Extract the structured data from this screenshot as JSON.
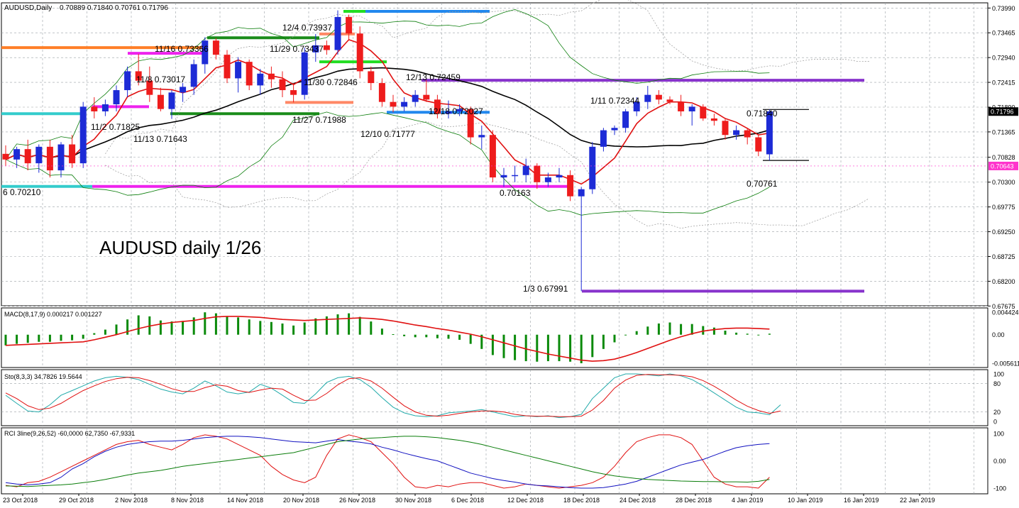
{
  "header": {
    "symbol": "AUDUSD,Daily",
    "ohlc": "0.70889 0.71840 0.70761 0.71796"
  },
  "watermark": "AUDUSD daily 1/26",
  "colors": {
    "bull": "#1d2bd6",
    "bear": "#ee1c1c",
    "ma_fast": "#e01010",
    "ma_slow": "#000000",
    "bb": "#0a7d0a",
    "grid": "#9aa0a6",
    "price_tag": "#000000",
    "level_tag": "#ff33cc",
    "cyan": "#33cccc",
    "orange": "#ff7f27",
    "magenta": "#ee22ee",
    "green": "#1a8c1a",
    "bright_green": "#22dd22",
    "blue": "#2288ee",
    "purple": "#8833cc",
    "salmon": "#ff8866"
  },
  "price_axis": {
    "labels": [
      "0.73990",
      "0.73465",
      "0.72940",
      "0.72415",
      "0.71890",
      "0.71365",
      "0.70828",
      "0.70300",
      "0.69775",
      "0.69250",
      "0.68725",
      "0.68200",
      "0.67675"
    ],
    "last_price": "0.71796",
    "level_tag": "0.70643"
  },
  "time_axis": {
    "labels": [
      "23 Oct 2018",
      "29 Oct 2018",
      "2 Nov 2018",
      "8 Nov 2018",
      "14 Nov 2018",
      "20 Nov 2018",
      "26 Nov 2018",
      "30 Nov 2018",
      "6 Dec 2018",
      "12 Dec 2018",
      "18 Dec 2018",
      "24 Dec 2018",
      "28 Dec 2018",
      "4 Jan 2019",
      "10 Jan 2019",
      "16 Jan 2019",
      "22 Jan 2019"
    ]
  },
  "annotations": [
    {
      "text": "12/4 0.73937"
    },
    {
      "text": "11/16 0.73366"
    },
    {
      "text": "11/29 0.73437"
    },
    {
      "text": "11/8 0.73017"
    },
    {
      "text": "11/30 0.72846"
    },
    {
      "text": "12/13 0.72459"
    },
    {
      "text": "1/11 0.72344"
    },
    {
      "text": "12/18 0.72027"
    },
    {
      "text": "0.71840"
    },
    {
      "text": "11/2 0.71825"
    },
    {
      "text": "11/27 0.71988"
    },
    {
      "text": "12/10 0.71777"
    },
    {
      "text": "11/13 0.71643"
    },
    {
      "text": "0.70761"
    },
    {
      "text": "6 0.70210"
    },
    {
      "text": "0.70163"
    },
    {
      "text": "1/3 0.67991"
    }
  ],
  "candles": [
    [
      0.709,
      0.7108,
      0.7065,
      0.7078
    ],
    [
      0.7078,
      0.7105,
      0.706,
      0.71
    ],
    [
      0.71,
      0.712,
      0.7055,
      0.707
    ],
    [
      0.707,
      0.711,
      0.705,
      0.7105
    ],
    [
      0.7105,
      0.712,
      0.704,
      0.7055
    ],
    [
      0.7055,
      0.7115,
      0.704,
      0.711
    ],
    [
      0.711,
      0.713,
      0.706,
      0.707
    ],
    [
      0.707,
      0.72,
      0.706,
      0.719
    ],
    [
      0.719,
      0.721,
      0.7165,
      0.718
    ],
    [
      0.718,
      0.7205,
      0.717,
      0.7195
    ],
    [
      0.7195,
      0.7235,
      0.718,
      0.7225
    ],
    [
      0.7225,
      0.7275,
      0.721,
      0.7265
    ],
    [
      0.7265,
      0.7302,
      0.7235,
      0.7245
    ],
    [
      0.7245,
      0.7275,
      0.72,
      0.7215
    ],
    [
      0.7215,
      0.723,
      0.718,
      0.7185
    ],
    [
      0.7185,
      0.7225,
      0.7164,
      0.722
    ],
    [
      0.722,
      0.724,
      0.72,
      0.7232
    ],
    [
      0.7232,
      0.729,
      0.7215,
      0.728
    ],
    [
      0.728,
      0.7337,
      0.726,
      0.733
    ],
    [
      0.733,
      0.7335,
      0.729,
      0.73
    ],
    [
      0.73,
      0.731,
      0.724,
      0.725
    ],
    [
      0.725,
      0.7295,
      0.722,
      0.7285
    ],
    [
      0.7285,
      0.729,
      0.7225,
      0.7235
    ],
    [
      0.7235,
      0.727,
      0.7215,
      0.726
    ],
    [
      0.726,
      0.7275,
      0.723,
      0.7248
    ],
    [
      0.7248,
      0.7265,
      0.721,
      0.7225
    ],
    [
      0.7225,
      0.724,
      0.7199,
      0.7215
    ],
    [
      0.7215,
      0.7315,
      0.7205,
      0.7305
    ],
    [
      0.7305,
      0.7344,
      0.7285,
      0.732
    ],
    [
      0.732,
      0.733,
      0.73,
      0.731
    ],
    [
      0.731,
      0.7394,
      0.73,
      0.738
    ],
    [
      0.738,
      0.7385,
      0.733,
      0.7345
    ],
    [
      0.7345,
      0.736,
      0.725,
      0.7265
    ],
    [
      0.7265,
      0.7275,
      0.7225,
      0.724
    ],
    [
      0.724,
      0.725,
      0.719,
      0.72
    ],
    [
      0.72,
      0.7215,
      0.7178,
      0.719
    ],
    [
      0.719,
      0.721,
      0.718,
      0.72
    ],
    [
      0.72,
      0.7225,
      0.719,
      0.7215
    ],
    [
      0.7215,
      0.7246,
      0.72,
      0.7205
    ],
    [
      0.7205,
      0.7215,
      0.7165,
      0.7175
    ],
    [
      0.7175,
      0.7203,
      0.7165,
      0.718
    ],
    [
      0.718,
      0.7195,
      0.717,
      0.7185
    ],
    [
      0.7185,
      0.719,
      0.711,
      0.7125
    ],
    [
      0.7125,
      0.715,
      0.71,
      0.713
    ],
    [
      0.713,
      0.714,
      0.703,
      0.704
    ],
    [
      0.704,
      0.706,
      0.702,
      0.7045
    ],
    [
      0.7045,
      0.7065,
      0.703,
      0.7045
    ],
    [
      0.7045,
      0.708,
      0.703,
      0.7065
    ],
    [
      0.7065,
      0.707,
      0.7016,
      0.703
    ],
    [
      0.703,
      0.705,
      0.702,
      0.704
    ],
    [
      0.704,
      0.706,
      0.703,
      0.7045
    ],
    [
      0.7045,
      0.7055,
      0.699,
      0.7
    ],
    [
      0.7,
      0.702,
      0.6799,
      0.7015
    ],
    [
      0.7015,
      0.7115,
      0.7005,
      0.7105
    ],
    [
      0.7105,
      0.7145,
      0.7095,
      0.714
    ],
    [
      0.714,
      0.715,
      0.713,
      0.7145
    ],
    [
      0.7145,
      0.7185,
      0.7135,
      0.718
    ],
    [
      0.718,
      0.721,
      0.717,
      0.72
    ],
    [
      0.72,
      0.7234,
      0.7185,
      0.7215
    ],
    [
      0.7215,
      0.7225,
      0.7195,
      0.7205
    ],
    [
      0.7205,
      0.7212,
      0.7195,
      0.72
    ],
    [
      0.72,
      0.7215,
      0.717,
      0.718
    ],
    [
      0.718,
      0.7195,
      0.715,
      0.719
    ],
    [
      0.719,
      0.7195,
      0.716,
      0.7165
    ],
    [
      0.7165,
      0.7175,
      0.715,
      0.716
    ],
    [
      0.716,
      0.7165,
      0.712,
      0.713
    ],
    [
      0.713,
      0.715,
      0.712,
      0.714
    ],
    [
      0.714,
      0.7145,
      0.711,
      0.7125
    ],
    [
      0.7125,
      0.713,
      0.7085,
      0.7095
    ],
    [
      0.7089,
      0.7184,
      0.7076,
      0.718
    ]
  ],
  "indicators": {
    "macd": {
      "label": "MACD(8,17,9) 0.000217 0.001227",
      "scale_labels": [
        "0.004424",
        "0.00",
        "-0.005611"
      ],
      "histogram": [
        -0.0021,
        -0.0018,
        -0.0016,
        -0.0014,
        -0.0014,
        -0.0012,
        -0.0011,
        -0.0008,
        0.0003,
        0.001,
        0.002,
        0.003,
        0.0038,
        0.0036,
        0.0028,
        0.0026,
        0.0027,
        0.0034,
        0.0044,
        0.0042,
        0.0036,
        0.0034,
        0.003,
        0.0027,
        0.0025,
        0.0022,
        0.0018,
        0.0024,
        0.0032,
        0.0036,
        0.004,
        0.0042,
        0.0035,
        0.0026,
        0.0012,
        0.0001,
        -0.0003,
        -0.0005,
        -0.0005,
        -0.0007,
        -0.0008,
        -0.001,
        -0.0018,
        -0.0028,
        -0.004,
        -0.0046,
        -0.005,
        -0.0052,
        -0.0053,
        -0.0052,
        -0.0052,
        -0.0053,
        -0.0056,
        -0.0044,
        -0.0028,
        -0.0015,
        0.0,
        0.0007,
        0.0016,
        0.0022,
        0.0024,
        0.0021,
        0.0021,
        0.0017,
        0.0014,
        0.0008,
        0.0004,
        0.0002,
        -0.0001,
        0.0002
      ],
      "signal": [
        -0.0021,
        -0.002,
        -0.0019,
        -0.0018,
        -0.0017,
        -0.0016,
        -0.0015,
        -0.0014,
        -0.001,
        -0.0005,
        0.0,
        0.0006,
        0.0012,
        0.0017,
        0.0021,
        0.0024,
        0.0026,
        0.0028,
        0.0032,
        0.0035,
        0.0036,
        0.0036,
        0.0035,
        0.0034,
        0.0032,
        0.003,
        0.0029,
        0.0028,
        0.0029,
        0.003,
        0.0031,
        0.0032,
        0.0033,
        0.0032,
        0.003,
        0.0027,
        0.0023,
        0.0019,
        0.0016,
        0.0012,
        0.0009,
        0.0005,
        0.0001,
        -0.0004,
        -0.001,
        -0.0016,
        -0.0022,
        -0.0028,
        -0.0033,
        -0.0038,
        -0.0042,
        -0.0046,
        -0.005,
        -0.0052,
        -0.0051,
        -0.0048,
        -0.0042,
        -0.0035,
        -0.0027,
        -0.0019,
        -0.0011,
        -0.0004,
        0.0002,
        0.0007,
        0.001,
        0.0012,
        0.0013,
        0.0013,
        0.0012,
        0.0011
      ]
    },
    "stochastic": {
      "label": "Sto(8,3,3) 34.7826 19.5644",
      "scale_labels": [
        "100",
        "80",
        "20",
        "0"
      ],
      "k": [
        55,
        38,
        22,
        20,
        35,
        55,
        65,
        75,
        85,
        92,
        95,
        93,
        88,
        78,
        68,
        62,
        58,
        70,
        85,
        75,
        62,
        58,
        62,
        78,
        70,
        55,
        40,
        38,
        58,
        82,
        92,
        95,
        88,
        72,
        50,
        30,
        18,
        12,
        10,
        12,
        18,
        20,
        22,
        25,
        20,
        15,
        10,
        12,
        10,
        12,
        8,
        10,
        15,
        48,
        70,
        92,
        100,
        100,
        98,
        96,
        100,
        96,
        88,
        75,
        60,
        45,
        30,
        20,
        18,
        14,
        35
      ],
      "d": [
        60,
        48,
        33,
        25,
        28,
        38,
        52,
        65,
        75,
        84,
        90,
        93,
        92,
        86,
        78,
        69,
        63,
        63,
        71,
        77,
        74,
        65,
        61,
        66,
        70,
        68,
        55,
        44,
        45,
        59,
        77,
        90,
        92,
        85,
        70,
        51,
        33,
        20,
        13,
        11,
        13,
        17,
        20,
        22,
        22,
        20,
        15,
        12,
        11,
        11,
        10,
        10,
        11,
        24,
        44,
        70,
        87,
        97,
        99,
        98,
        98,
        97,
        94,
        86,
        74,
        60,
        45,
        32,
        23,
        17,
        22
      ]
    },
    "rci": {
      "label": "RCI 3line(9,26,52) -60,0000 62,7350 -67,9331",
      "scale_labels": [
        "100",
        "0.00",
        "-100"
      ],
      "short": [
        -90,
        -95,
        -80,
        -75,
        -60,
        -40,
        -20,
        0,
        20,
        40,
        60,
        70,
        75,
        60,
        50,
        40,
        60,
        85,
        95,
        90,
        80,
        60,
        40,
        20,
        -20,
        -50,
        -70,
        -80,
        -60,
        20,
        80,
        95,
        85,
        70,
        30,
        -10,
        -60,
        -95,
        -100,
        -90,
        -95,
        -85,
        -80,
        -80,
        -90,
        -100,
        -95,
        -85,
        -90,
        -95,
        -100,
        -95,
        -90,
        -80,
        -60,
        -20,
        30,
        70,
        85,
        95,
        95,
        85,
        60,
        0,
        -60,
        -85,
        -95,
        -95,
        -100,
        -60
      ],
      "middle": [
        -80,
        -85,
        -88,
        -85,
        -80,
        -60,
        -30,
        -10,
        15,
        35,
        50,
        60,
        66,
        70,
        72,
        72,
        75,
        80,
        85,
        88,
        90,
        90,
        88,
        85,
        80,
        75,
        70,
        68,
        66,
        72,
        78,
        72,
        68,
        62,
        50,
        40,
        28,
        18,
        8,
        0,
        -15,
        -30,
        -45,
        -55,
        -65,
        -72,
        -78,
        -85,
        -90,
        -92,
        -95,
        -98,
        -100,
        -100,
        -98,
        -92,
        -85,
        -75,
        -60,
        -45,
        -30,
        -15,
        -5,
        5,
        20,
        35,
        48,
        55,
        60,
        63
      ],
      "long": [
        -92,
        -93,
        -94,
        -92,
        -90,
        -88,
        -85,
        -80,
        -75,
        -68,
        -60,
        -52,
        -45,
        -40,
        -35,
        -28,
        -20,
        -15,
        -10,
        -5,
        0,
        5,
        10,
        15,
        20,
        25,
        30,
        40,
        50,
        60,
        70,
        75,
        80,
        83,
        85,
        88,
        90,
        90,
        88,
        85,
        80,
        75,
        68,
        60,
        50,
        40,
        30,
        20,
        10,
        0,
        -10,
        -20,
        -30,
        -40,
        -48,
        -55,
        -60,
        -65,
        -68,
        -70,
        -72,
        -74,
        -75,
        -76,
        -76,
        -77,
        -77,
        -78,
        -75,
        -68
      ]
    }
  }
}
